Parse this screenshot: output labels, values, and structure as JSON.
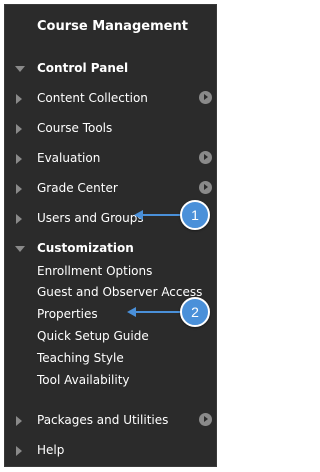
{
  "panel": {
    "title": "Course Management",
    "control_panel": "Control Panel",
    "items": [
      {
        "label": "Content Collection"
      },
      {
        "label": "Course Tools"
      },
      {
        "label": "Evaluation"
      },
      {
        "label": "Grade Center"
      },
      {
        "label": "Users and Groups"
      },
      {
        "label": "Customization"
      }
    ],
    "customization_sub": [
      "Enrollment Options",
      "Guest and Observer Access",
      "Properties",
      "Quick Setup Guide",
      "Teaching Style",
      "Tool Availability"
    ],
    "bottom_items": [
      {
        "label": "Packages and Utilities"
      },
      {
        "label": "Help"
      }
    ]
  },
  "callouts": [
    "1",
    "2"
  ],
  "colors": {
    "panel_bg": "#2b2b2b",
    "callout": "#4a90d9",
    "arrow": "#8a8a8a"
  }
}
